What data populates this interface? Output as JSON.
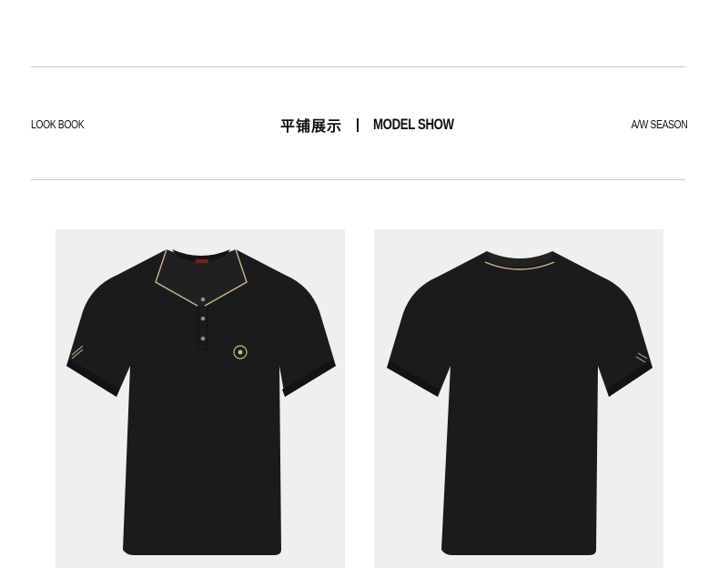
{
  "header": {
    "left_label": "LOOK BOOK",
    "title_cn": "平铺展示",
    "title_en": "MODEL SHOW",
    "right_label": "A/W SEASON"
  },
  "gallery": {
    "items": [
      {
        "view": "front",
        "garment": "black polo shirt",
        "background": "#efeff0"
      },
      {
        "view": "back",
        "garment": "black polo shirt",
        "background": "#efeff0"
      }
    ],
    "accent_colors": {
      "shirt": "#1b1b1d",
      "trim": "#c9b68a"
    }
  }
}
